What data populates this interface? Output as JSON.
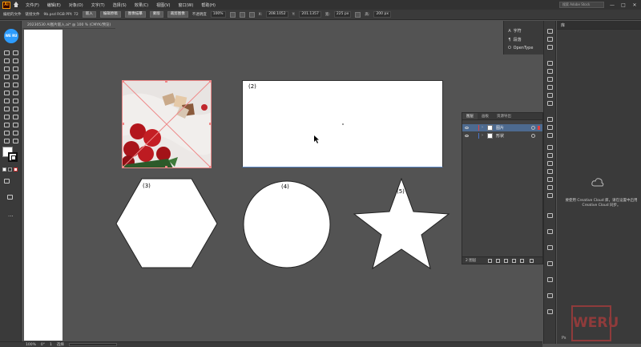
{
  "menubar": {
    "logo": "Ai",
    "items": [
      "文件(F)",
      "编辑(E)",
      "对象(O)",
      "文字(T)",
      "选择(S)",
      "效果(C)",
      "视图(V)",
      "窗口(W)",
      "帮助(H)"
    ],
    "search_placeholder": "搜索 Adobe Stock",
    "window_buttons": [
      "—",
      "□",
      "✕"
    ]
  },
  "controlbar": {
    "mode_label": "编组的文件",
    "file_label": "链接文件",
    "file_info": "9b.psd RGB PPI: 72",
    "buttons": [
      "嵌入",
      "编辑原稿",
      "图像描摹",
      "蒙版",
      "裁剪图像"
    ],
    "opacity_label": "不透明度",
    "opacity_value": "100%",
    "x_label": "X:",
    "x_value": "208.1052",
    "y_label": "Y:",
    "y_value": "201.1357",
    "w_label": "宽:",
    "w_value": "225 px",
    "h_label": "高:",
    "h_value": "200 px"
  },
  "document": {
    "tab_title": "20230530 AI图片嵌入.ai* @ 100 % (CMYK/预览)"
  },
  "toolpanel": {
    "cc_badge": "WE RU"
  },
  "canvas": {
    "labels": [
      "(2)",
      "(3)",
      "(4)",
      "(5)"
    ]
  },
  "layers_panel": {
    "tabs": [
      "图层",
      "画板",
      "资源导出"
    ],
    "layers": [
      {
        "name": "图片",
        "color": "#e34040",
        "selected": true
      },
      {
        "name": "形状",
        "color": "#4a76c8",
        "selected": false
      }
    ],
    "footer_label": "2 图层"
  },
  "character_panel": {
    "items": [
      {
        "icon": "A",
        "label": "字符"
      },
      {
        "icon": "¶",
        "label": "段落"
      },
      {
        "icon": "O",
        "label": "OpenType"
      }
    ]
  },
  "libraries_panel": {
    "title": "库",
    "message": "要使用 Creative Cloud 库，请在设置中启用 Creative Cloud 同步。",
    "footer": "Ps"
  },
  "statusbar": {
    "zoom": "100%",
    "angle": "0°",
    "artboard_nav": "1",
    "tool": "选择"
  },
  "watermark": {
    "text": "WERU"
  }
}
